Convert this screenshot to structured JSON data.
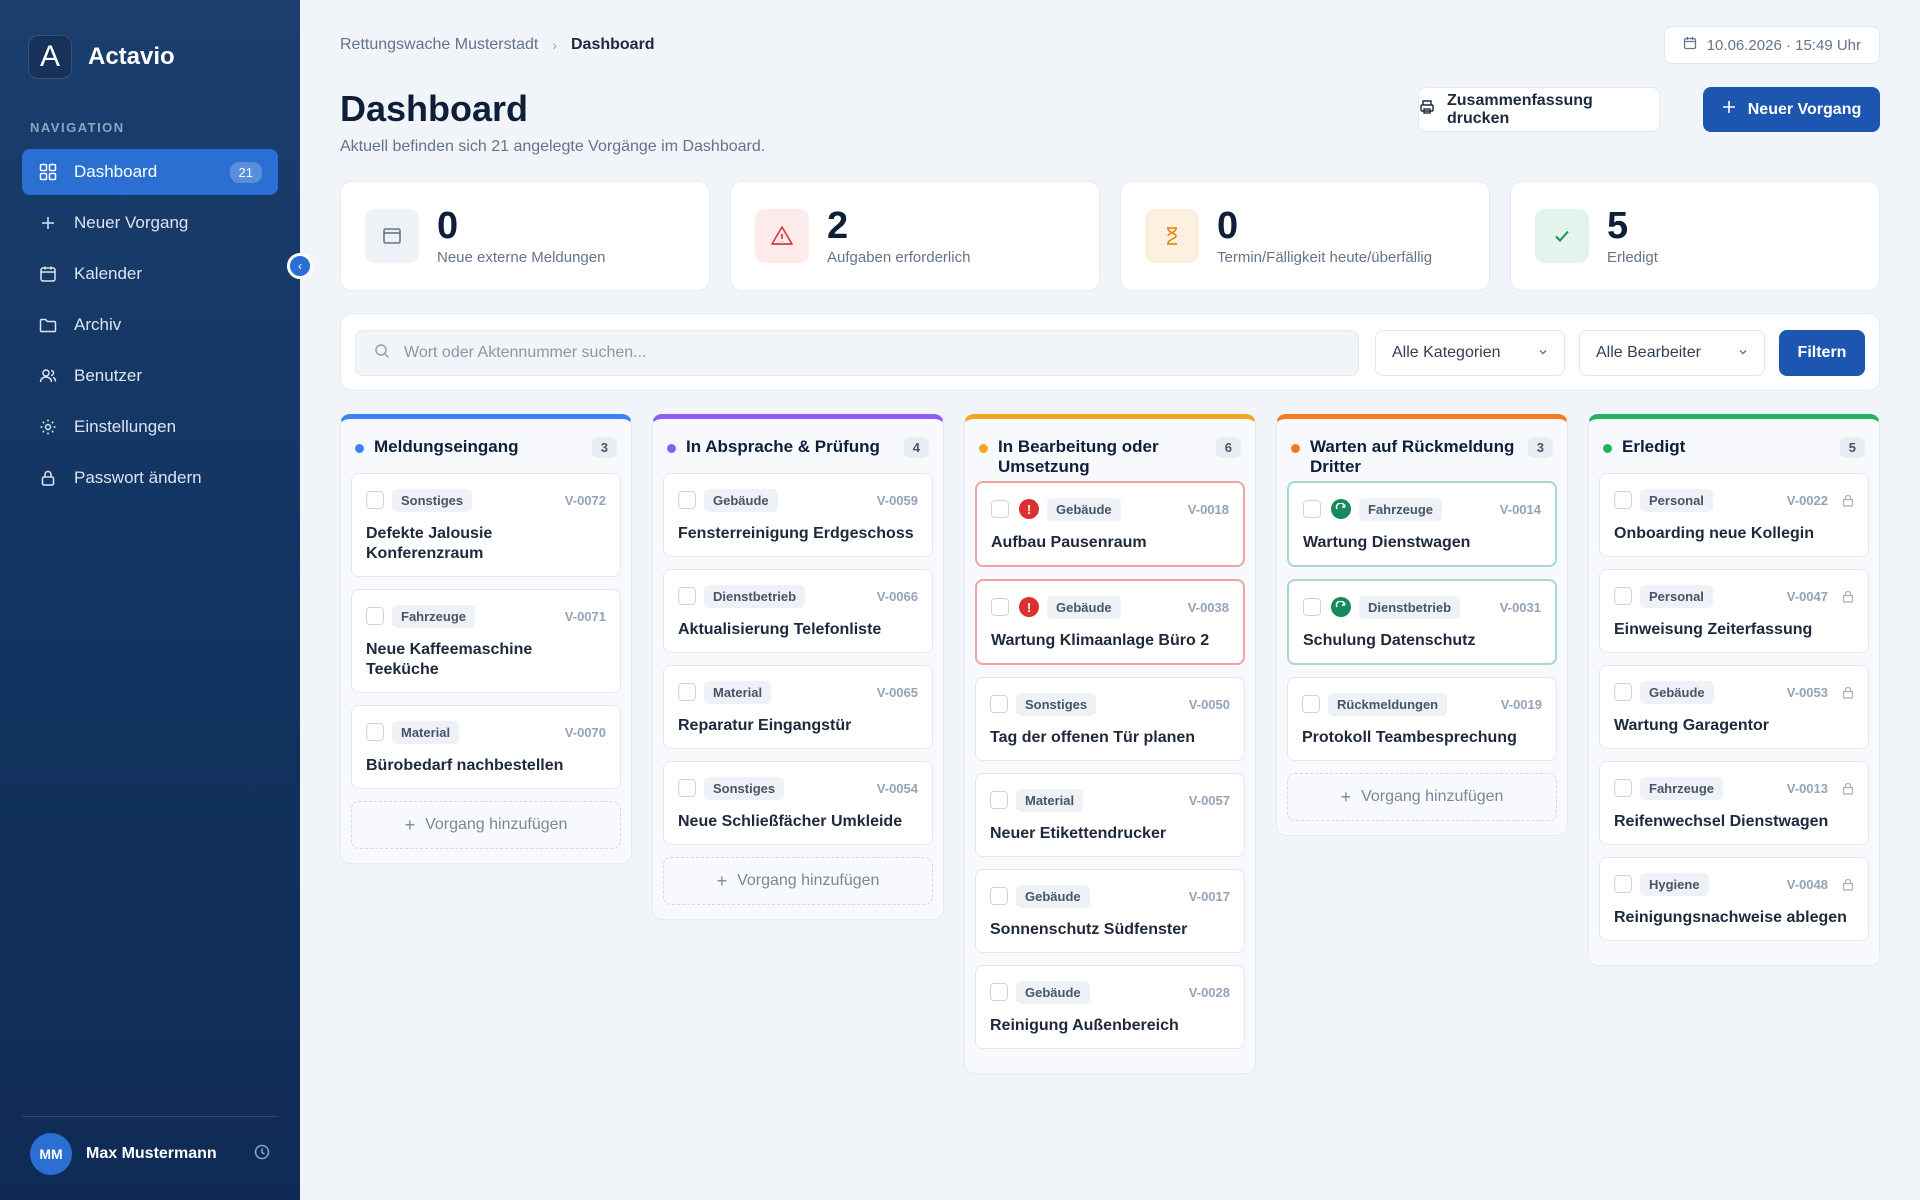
{
  "app": {
    "name": "Actavio",
    "logo_letter": "A"
  },
  "sidebar": {
    "heading": "NAVIGATION",
    "items": [
      {
        "label": "Dashboard",
        "icon": "grid-icon",
        "badge": "21",
        "active": true
      },
      {
        "label": "Neuer Vorgang",
        "icon": "plus-icon"
      },
      {
        "label": "Kalender",
        "icon": "calendar-icon"
      },
      {
        "label": "Archiv",
        "icon": "folder-icon"
      },
      {
        "label": "Benutzer",
        "icon": "users-icon"
      },
      {
        "label": "Einstellungen",
        "icon": "gear-icon"
      },
      {
        "label": "Passwort ändern",
        "icon": "lock-icon"
      }
    ],
    "user": {
      "initials": "MM",
      "name": "Max Mustermann"
    }
  },
  "header": {
    "breadcrumb": [
      "Rettungswache Musterstadt",
      "Dashboard"
    ],
    "datetime": "10.06.2026 · 15:49 Uhr",
    "title": "Dashboard",
    "subtitle": "Aktuell befinden sich 21 angelegte Vorgänge im Dashboard.",
    "print_label": "Zusammenfassung drucken",
    "new_label": "Neuer Vorgang"
  },
  "stats": [
    {
      "value": "0",
      "label": "Neue externe Meldungen",
      "icon": "inbox-icon",
      "color": "#64748b",
      "bg": "#eef1f5"
    },
    {
      "value": "2",
      "label": "Aufgaben erforderlich",
      "icon": "warning-icon",
      "color": "#dc3b3b",
      "bg": "#fdeaea"
    },
    {
      "value": "0",
      "label": "Termin/Fälligkeit heute/überfällig",
      "icon": "hourglass-icon",
      "color": "#e58a1f",
      "bg": "#fdf0df"
    },
    {
      "value": "5",
      "label": "Erledigt",
      "icon": "check-icon",
      "color": "#17915f",
      "bg": "#e3f4ec"
    }
  ],
  "filters": {
    "search_placeholder": "Wort oder Aktennummer suchen...",
    "category": "Alle Kategorien",
    "assignee": "Alle Bearbeiter",
    "button": "Filtern"
  },
  "add_label": "Vorgang hinzufügen",
  "columns": [
    {
      "title": "Meldungseingang",
      "count": "3",
      "color": "#3b82f6",
      "add": true,
      "cards": [
        {
          "tag": "Sonstiges",
          "id": "V-0072",
          "title": "Defekte Jalousie Konferenzraum"
        },
        {
          "tag": "Fahrzeuge",
          "id": "V-0071",
          "title": "Neue Kaffeemaschine Teeküche"
        },
        {
          "tag": "Material",
          "id": "V-0070",
          "title": "Bürobedarf nachbestellen"
        }
      ]
    },
    {
      "title": "In Absprache & Prüfung",
      "count": "4",
      "color": "#8b5cf6",
      "add": true,
      "cards": [
        {
          "tag": "Gebäude",
          "id": "V-0059",
          "title": "Fensterreinigung Erdgeschoss"
        },
        {
          "tag": "Dienstbetrieb",
          "id": "V-0066",
          "title": "Aktualisierung Telefonliste"
        },
        {
          "tag": "Material",
          "id": "V-0065",
          "title": "Reparatur Eingangstür"
        },
        {
          "tag": "Sonstiges",
          "id": "V-0054",
          "title": "Neue Schließfächer Umkleide"
        }
      ]
    },
    {
      "title": "In Bearbeitung oder Umsetzung",
      "count": "6",
      "color": "#f5a524",
      "add": false,
      "cards": [
        {
          "tag": "Gebäude",
          "id": "V-0018",
          "title": "Aufbau Pausenraum",
          "flag": "alert"
        },
        {
          "tag": "Gebäude",
          "id": "V-0038",
          "title": "Wartung Klimaanlage Büro 2",
          "flag": "alert"
        },
        {
          "tag": "Sonstiges",
          "id": "V-0050",
          "title": "Tag der offenen Tür planen"
        },
        {
          "tag": "Material",
          "id": "V-0057",
          "title": "Neuer Etikettendrucker"
        },
        {
          "tag": "Gebäude",
          "id": "V-0017",
          "title": "Sonnenschutz Südfenster"
        },
        {
          "tag": "Gebäude",
          "id": "V-0028",
          "title": "Reinigung Außenbereich"
        }
      ]
    },
    {
      "title": "Warten auf Rückmeldung Dritter",
      "count": "3",
      "color": "#f47b20",
      "add": true,
      "cards": [
        {
          "tag": "Fahrzeuge",
          "id": "V-0014",
          "title": "Wartung Dienstwagen",
          "flag": "wait"
        },
        {
          "tag": "Dienstbetrieb",
          "id": "V-0031",
          "title": "Schulung Datenschutz",
          "flag": "wait"
        },
        {
          "tag": "Rückmeldungen",
          "id": "V-0019",
          "title": "Protokoll Teambesprechung"
        }
      ]
    },
    {
      "title": "Erledigt",
      "count": "5",
      "color": "#22b35e",
      "add": false,
      "locked": true,
      "cards": [
        {
          "tag": "Personal",
          "id": "V-0022",
          "title": "Onboarding neue Kollegin"
        },
        {
          "tag": "Personal",
          "id": "V-0047",
          "title": "Einweisung Zeiterfassung"
        },
        {
          "tag": "Gebäude",
          "id": "V-0053",
          "title": "Wartung Garagentor"
        },
        {
          "tag": "Fahrzeuge",
          "id": "V-0013",
          "title": "Reifenwechsel Dienstwagen"
        },
        {
          "tag": "Hygiene",
          "id": "V-0048",
          "title": "Reinigungsnachweise ablegen"
        }
      ]
    }
  ]
}
